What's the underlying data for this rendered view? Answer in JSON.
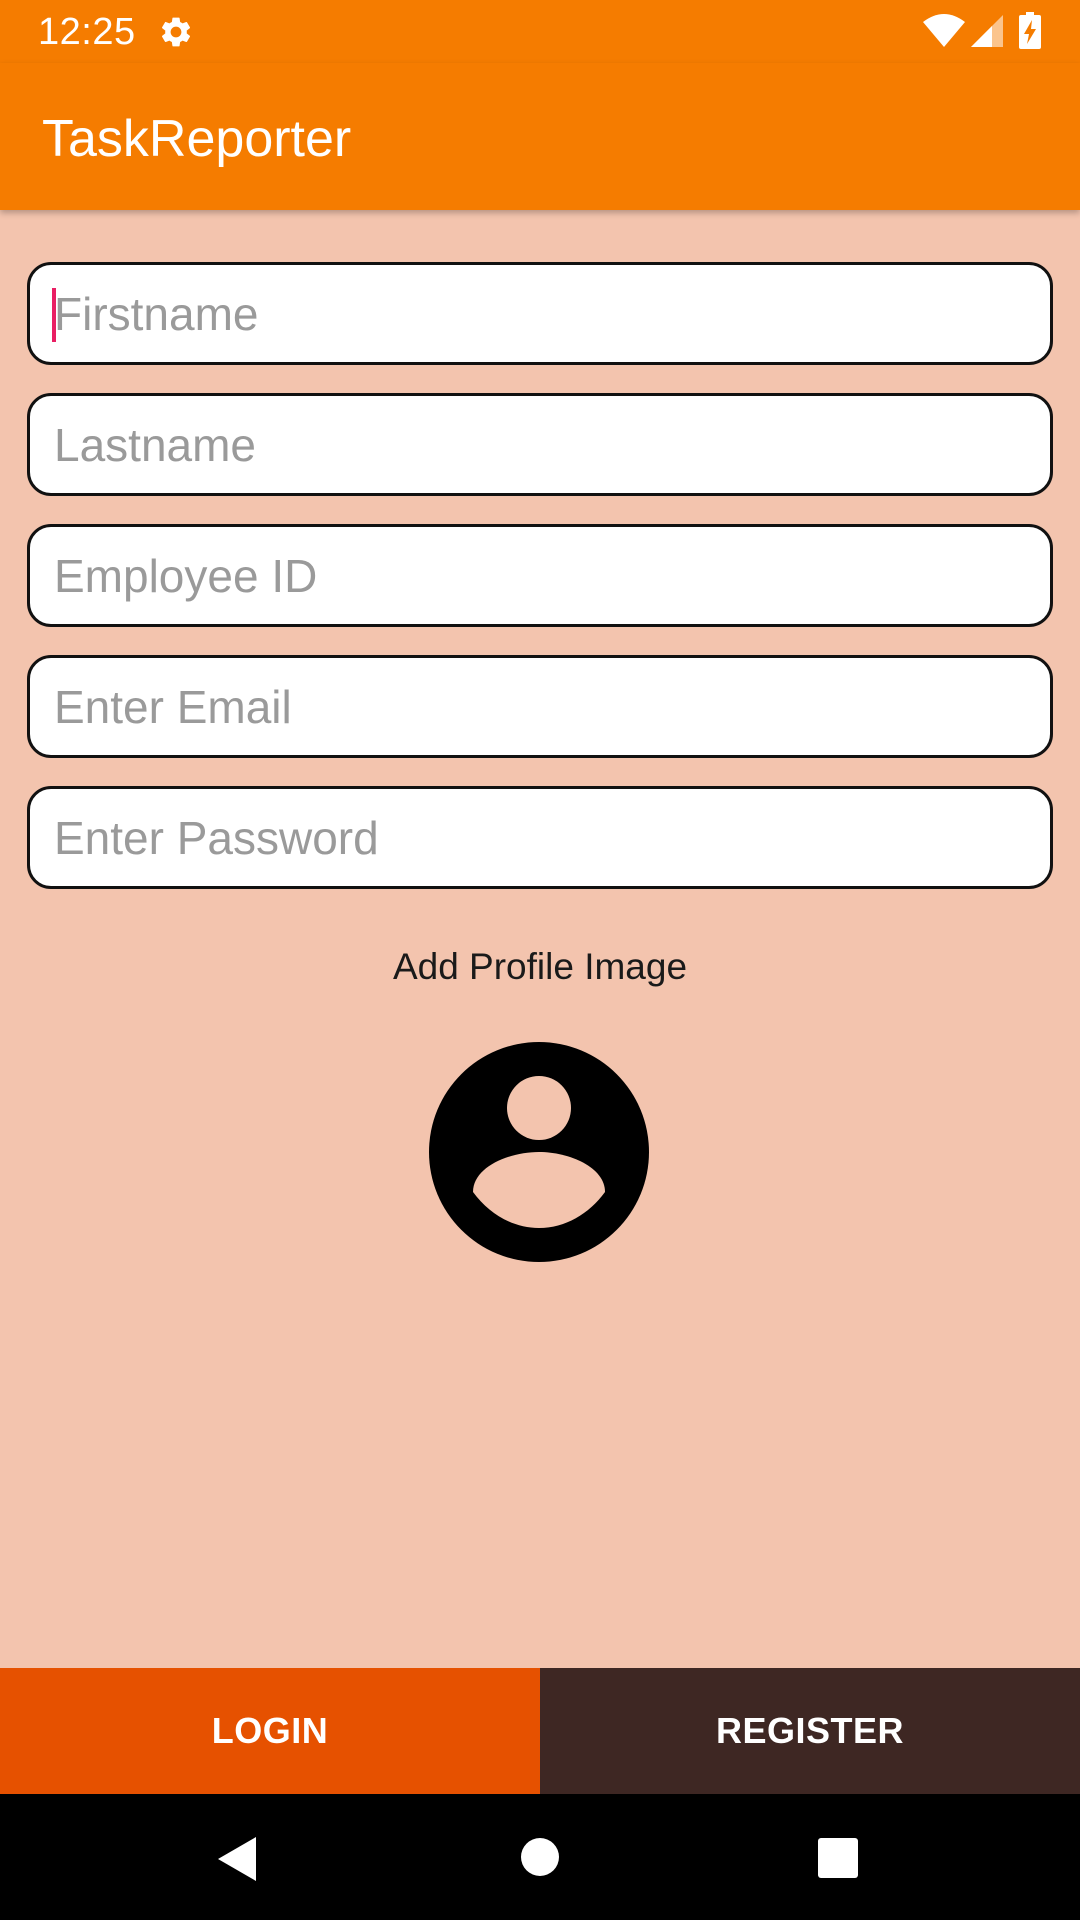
{
  "status_bar": {
    "time": "12:25",
    "icons": [
      "gear-icon",
      "wifi-icon",
      "signal-icon",
      "battery-charging-icon"
    ]
  },
  "app_bar": {
    "title": "TaskReporter",
    "color": "#f57c00"
  },
  "form": {
    "firstname_placeholder": "Firstname",
    "lastname_placeholder": "Lastname",
    "employee_id_placeholder": "Employee ID",
    "email_placeholder": "Enter Email",
    "password_placeholder": "Enter Password",
    "focused_field": "firstname"
  },
  "profile": {
    "label": "Add Profile Image",
    "icon": "account-circle-icon"
  },
  "buttons": {
    "login_label": "LOGIN",
    "register_label": "REGISTER",
    "login_color": "#e65100",
    "register_color": "#3e2723"
  },
  "nav_bar": {
    "icons": [
      "back-icon",
      "home-icon",
      "recents-icon"
    ]
  },
  "colors": {
    "background": "#f3c4ae",
    "caret": "#e91e63"
  }
}
